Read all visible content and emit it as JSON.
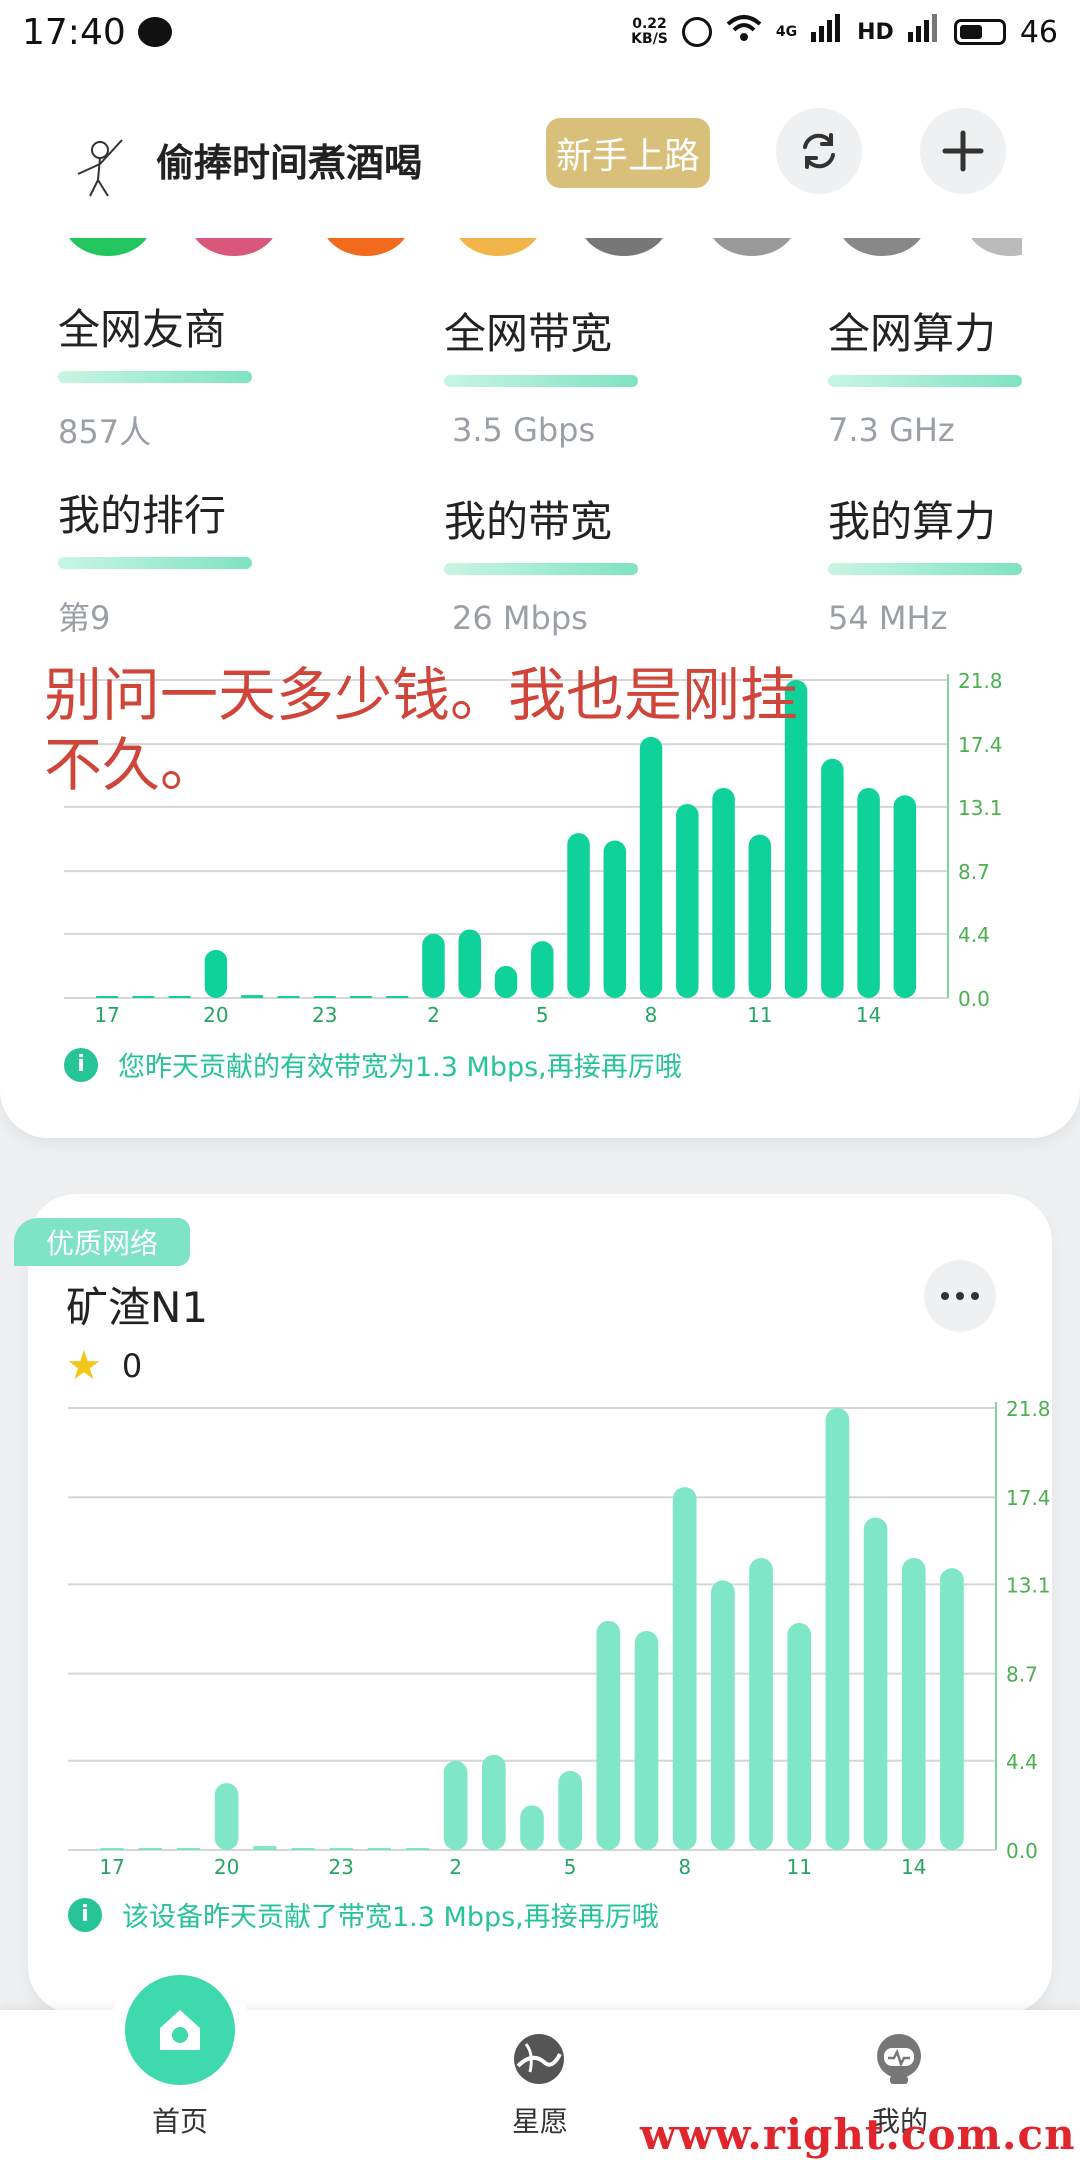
{
  "status_bar": {
    "time": "17:40",
    "net_speed_value": "0.22",
    "net_speed_unit": "KB/S",
    "network": "4G",
    "hd": "HD",
    "battery": "46"
  },
  "header": {
    "username": "偷捧时间煮酒喝",
    "newbie_label": "新手上路"
  },
  "stats": [
    {
      "label": "全网友商",
      "value": "857人"
    },
    {
      "label": "全网带宽",
      "value": "3.5 Gbps"
    },
    {
      "label": "全网算力",
      "value": "7.3 GHz"
    },
    {
      "label": "我的排行",
      "value": "第9"
    },
    {
      "label": "我的带宽",
      "value": "26 Mbps"
    },
    {
      "label": "我的算力",
      "value": "54 MHz"
    }
  ],
  "overlay_text": "别问一天多少钱。我也是刚挂不久。",
  "summary_tip": "您昨天贡献的有效带宽为1.3 Mbps,再接再厉哦",
  "device": {
    "badge": "优质网络",
    "name": "矿渣N1",
    "stars": "0",
    "tip": "该设备昨天贡献了带宽1.3 Mbps,再接再厉哦"
  },
  "nav": {
    "home": "首页",
    "wish": "星愿",
    "mine": "我的"
  },
  "watermark": "www.right.com.cn",
  "colors": {
    "accent": "#0fd19a",
    "accent_light": "#7fe6c8",
    "accent_mid": "#3fdcb0",
    "gold": "#d8c07a",
    "annotation_red": "#d0453a"
  },
  "chart_data": [
    {
      "type": "bar",
      "x_tick_labels": [
        "17",
        "20",
        "23",
        "2",
        "5",
        "8",
        "11",
        "14"
      ],
      "x": [
        17,
        18,
        19,
        20,
        21,
        22,
        23,
        24,
        1,
        2,
        3,
        4,
        5,
        6,
        7,
        8,
        9,
        10,
        11,
        12,
        13,
        14,
        15
      ],
      "values": [
        0,
        0,
        0,
        3.3,
        0.2,
        0.1,
        0,
        0,
        0.05,
        4.4,
        4.7,
        2.2,
        3.9,
        11.3,
        10.8,
        17.9,
        13.3,
        14.4,
        11.2,
        21.8,
        16.4,
        14.4,
        13.9
      ],
      "y_ticks": [
        0.0,
        4.4,
        8.7,
        13.1,
        17.4,
        21.8
      ],
      "ylim": [
        0,
        21.8
      ],
      "grid": true
    },
    {
      "type": "bar",
      "x_tick_labels": [
        "17",
        "20",
        "23",
        "2",
        "5",
        "8",
        "11",
        "14"
      ],
      "x": [
        17,
        18,
        19,
        20,
        21,
        22,
        23,
        24,
        1,
        2,
        3,
        4,
        5,
        6,
        7,
        8,
        9,
        10,
        11,
        12,
        13,
        14,
        15
      ],
      "values": [
        0,
        0,
        0,
        3.3,
        0.2,
        0.1,
        0,
        0,
        0.05,
        4.4,
        4.7,
        2.2,
        3.9,
        11.3,
        10.8,
        17.9,
        13.3,
        14.4,
        11.2,
        21.8,
        16.4,
        14.4,
        13.9
      ],
      "y_ticks": [
        0.0,
        4.4,
        8.7,
        13.1,
        17.4,
        21.8
      ],
      "ylim": [
        0,
        21.8
      ],
      "grid": true
    }
  ]
}
